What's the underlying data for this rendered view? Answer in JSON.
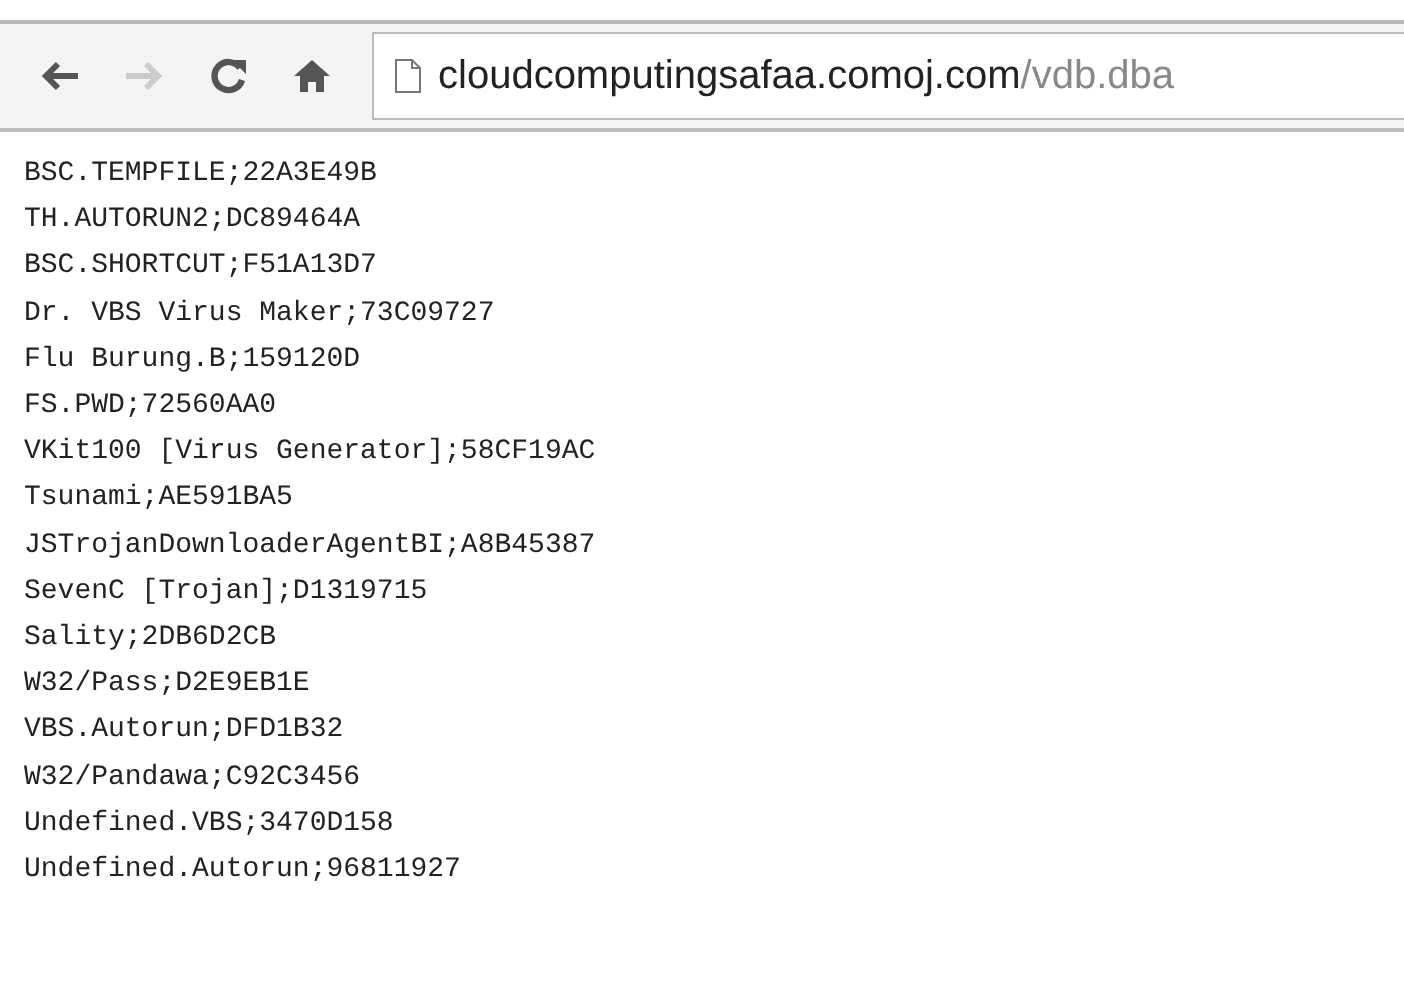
{
  "toolbar": {
    "back": {
      "disabled": false
    },
    "forward": {
      "disabled": true
    }
  },
  "address_bar": {
    "host": "cloudcomputingsafaa.comoj.com",
    "path": "/vdb.dba"
  },
  "content": {
    "lines": [
      "BSC.TEMPFILE;22A3E49B",
      "TH.AUTORUN2;DC89464A",
      "BSC.SHORTCUT;F51A13D7",
      "Dr. VBS Virus Maker;73C09727",
      "Flu Burung.B;159120D",
      "FS.PWD;72560AA0",
      "VKit100 [Virus Generator];58CF19AC",
      "Tsunami;AE591BA5",
      "JSTrojanDownloaderAgentBI;A8B45387",
      "SevenC [Trojan];D1319715",
      "Sality;2DB6D2CB",
      "W32/Pass;D2E9EB1E",
      "VBS.Autorun;DFD1B32",
      "W32/Pandawa;C92C3456",
      "Undefined.VBS;3470D158",
      "Undefined.Autorun;96811927"
    ]
  }
}
